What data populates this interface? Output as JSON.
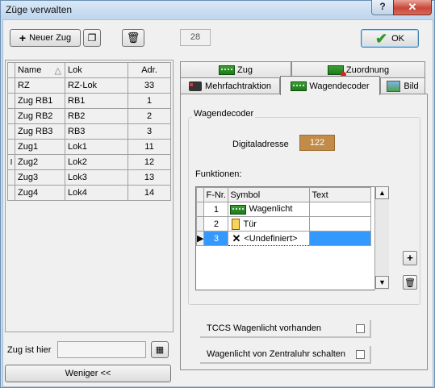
{
  "window": {
    "title": "Züge verwalten",
    "help_label": "?",
    "close_label": "✕"
  },
  "toolbar": {
    "new_train_label": "Neuer Zug",
    "counter": "28",
    "ok_label": "OK"
  },
  "trains": {
    "headers": [
      "Name",
      "Lok",
      "Adr."
    ],
    "rows": [
      {
        "name": "RZ",
        "lok": "RZ-Lok",
        "adr": "33"
      },
      {
        "name": "Zug RB1",
        "lok": "RB1",
        "adr": "1"
      },
      {
        "name": "Zug RB2",
        "lok": "RB2",
        "adr": "2"
      },
      {
        "name": "Zug RB3",
        "lok": "RB3",
        "adr": "3"
      },
      {
        "name": "Zug1",
        "lok": "Lok1",
        "adr": "11"
      },
      {
        "name": "Zug2",
        "lok": "Lok2",
        "adr": "12"
      },
      {
        "name": "Zug3",
        "lok": "Lok3",
        "adr": "13"
      },
      {
        "name": "Zug4",
        "lok": "Lok4",
        "adr": "14"
      }
    ],
    "selected_index": 5
  },
  "location": {
    "label": "Zug ist hier",
    "value": ""
  },
  "less_button_label": "Weniger <<",
  "tabs": [
    {
      "label": "Zug"
    },
    {
      "label": "Zuordnung"
    },
    {
      "label": "Mehrfachtraktion"
    },
    {
      "label": "Wagendecoder"
    },
    {
      "label": "Bild"
    }
  ],
  "wagendecoder": {
    "group_title": "Wagendecoder",
    "address_label": "Digitaladresse",
    "address_value": "122",
    "functions_label": "Funktionen:",
    "function_headers": [
      "F-Nr.",
      "Symbol",
      "Text"
    ],
    "functions": [
      {
        "nr": "1",
        "symbol": "Wagenlicht",
        "text": ""
      },
      {
        "nr": "2",
        "symbol": "Tür",
        "text": ""
      },
      {
        "nr": "3",
        "symbol": "<Undefiniert>",
        "text": ""
      }
    ],
    "tccs_label": "TCCS Wagenlicht vorhanden",
    "clock_label": "Wagenlicht von Zentraluhr schalten"
  },
  "colors": {
    "address_bg": "#c28c48",
    "selection": "#3399ff",
    "ok_check": "#2a9a2a"
  }
}
